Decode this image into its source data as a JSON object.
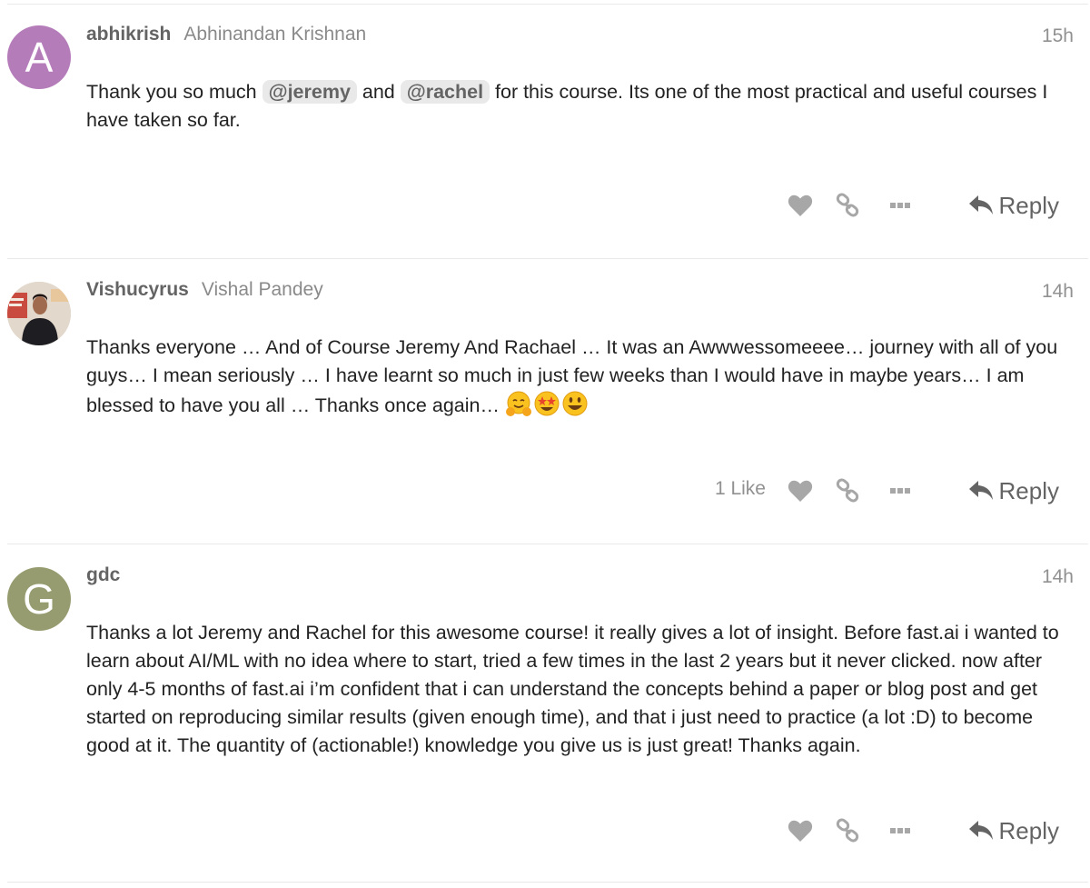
{
  "colors": {
    "avatar_a": "#b57cba",
    "avatar_g": "#969c6f",
    "mention_bg": "#e9e9e9",
    "icon_gray": "#a7a7a7",
    "muted_text": "#919191"
  },
  "posts": [
    {
      "username": "abhikrish",
      "full_name": "Abhinandan Krishnan",
      "time": "15h",
      "avatar_letter": "A",
      "body": {
        "t1": "Thank you so much ",
        "mention1": "@jeremy",
        "t2": " and ",
        "mention2": "@rachel",
        "t3": " for this course. Its one of the most practical and useful courses I have taken so far."
      },
      "reply_label": "Reply",
      "icons": [
        "heart-icon",
        "link-icon",
        "more-icon",
        "reply-icon"
      ]
    },
    {
      "username": "Vishucyrus",
      "full_name": "Vishal Pandey",
      "time": "14h",
      "body": "Thanks everyone … And of Course Jeremy And Rachael … It was an Awwwessomeeee… journey with all of you guys… I mean seriously … I have learnt so much in just few weeks than I would have in maybe years… I am blessed to have you all … Thanks once again… ",
      "emojis": [
        "hugging-face-emoji",
        "star-struck-emoji",
        "smiley-emoji"
      ],
      "likes": "1 Like",
      "reply_label": "Reply"
    },
    {
      "username": "gdc",
      "full_name": "",
      "time": "14h",
      "avatar_letter": "G",
      "body": "Thanks a lot Jeremy and Rachel for this awesome course! it really gives a lot of insight. Before fast.ai i wanted to learn about AI/ML with no idea where to start, tried a few times in the last 2 years but it never clicked. now after only 4-5 months of fast.ai i’m confident that i can understand the concepts behind a paper or blog post and get started on reproducing similar results (given enough time), and that i just need to practice (a lot :D) to become good at it. The quantity of (actionable!) knowledge you give us is just great! Thanks again.",
      "reply_label": "Reply"
    }
  ]
}
